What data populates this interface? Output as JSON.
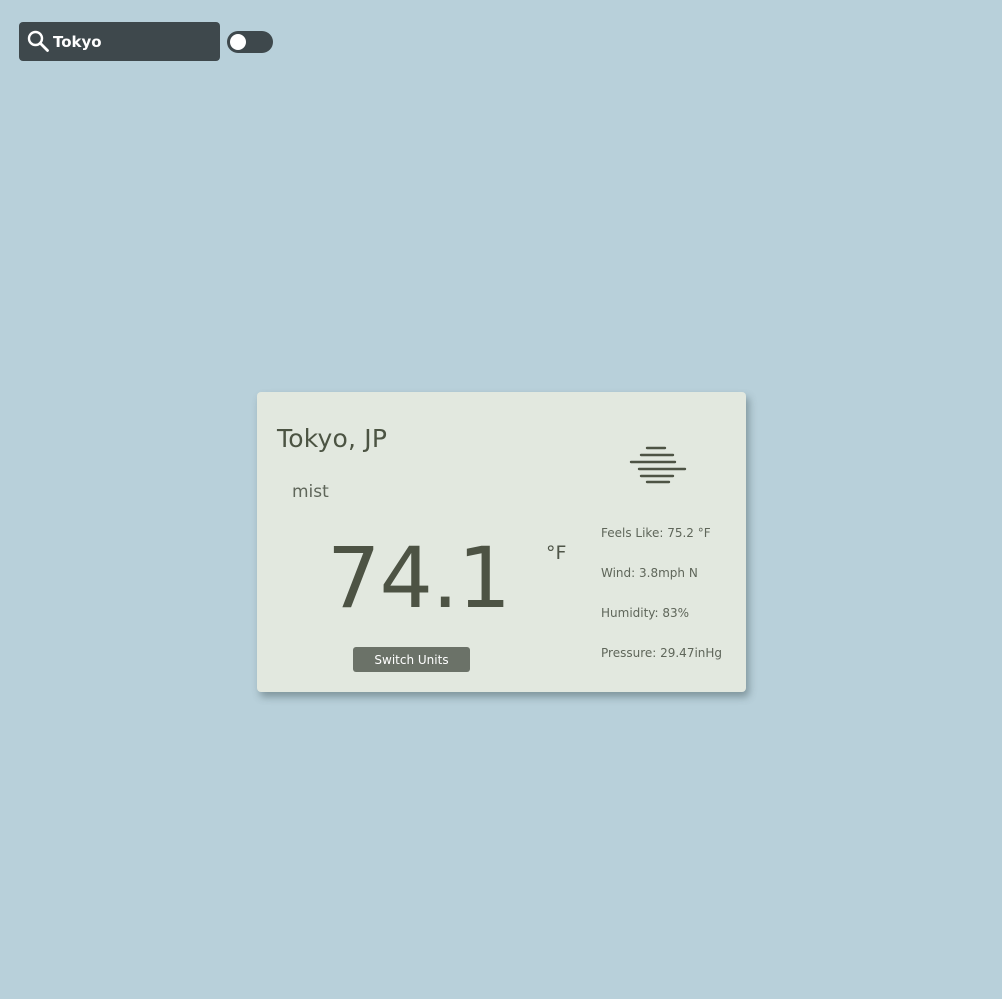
{
  "search": {
    "value": "Tokyo",
    "icon": "search-icon"
  },
  "toggle": {
    "state": "off"
  },
  "weather": {
    "location": "Tokyo, JP",
    "condition": "mist",
    "condition_icon": "mist-icon",
    "temperature": "74.1",
    "unit": "°F",
    "switch_label": "Switch Units",
    "details": {
      "feels_like": "Feels Like: 75.2 °F",
      "wind": "Wind: 3.8mph N",
      "humidity": "Humidity: 83%",
      "pressure": "Pressure: 29.47inHg"
    }
  },
  "colors": {
    "background": "#b8d0da",
    "card": "#e2e8df",
    "dark": "#3e484c",
    "button": "#6b7268",
    "text": "#4c5443"
  }
}
